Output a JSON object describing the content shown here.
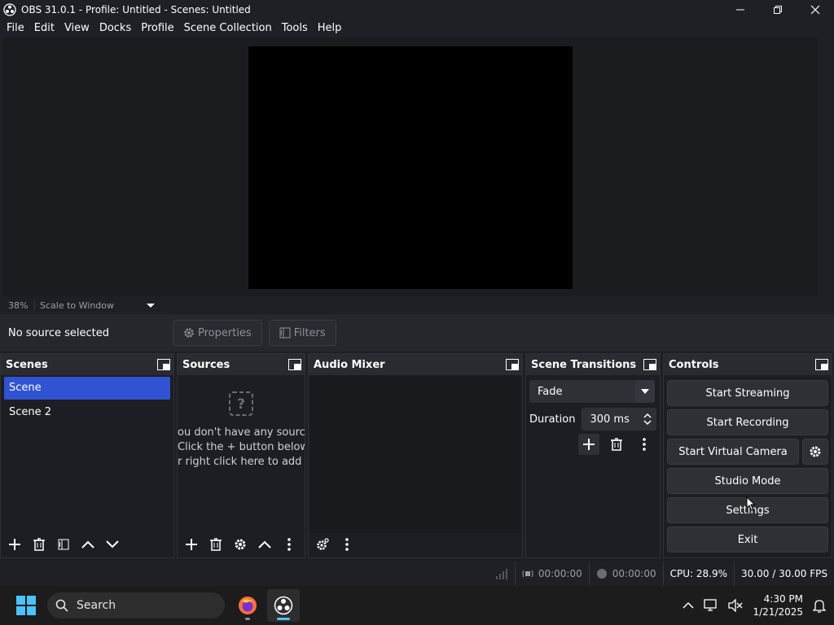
{
  "window": {
    "title": "OBS 31.0.1 - Profile: Untitled - Scenes: Untitled"
  },
  "menu": [
    "File",
    "Edit",
    "View",
    "Docks",
    "Profile",
    "Scene Collection",
    "Tools",
    "Help"
  ],
  "preview": {
    "zoom": "38%",
    "scale_mode": "Scale to Window"
  },
  "source_bar": {
    "status": "No source selected",
    "properties_label": "Properties",
    "filters_label": "Filters"
  },
  "scenes": {
    "title": "Scenes",
    "items": [
      {
        "label": "Scene",
        "selected": true
      },
      {
        "label": "Scene 2",
        "selected": false
      }
    ]
  },
  "sources": {
    "title": "Sources",
    "empty_lines": [
      "ou don't have any source",
      "Click the + button below,",
      "r right click here to add or"
    ]
  },
  "audio_mixer": {
    "title": "Audio Mixer"
  },
  "transitions": {
    "title": "Scene Transitions",
    "selected": "Fade",
    "duration_label": "Duration",
    "duration_value": "300 ms"
  },
  "controls": {
    "title": "Controls",
    "start_streaming": "Start Streaming",
    "start_recording": "Start Recording",
    "start_virtual_camera": "Start Virtual Camera",
    "studio_mode": "Studio Mode",
    "settings": "Settings",
    "exit": "Exit"
  },
  "status": {
    "stream_time": "00:00:00",
    "record_time": "00:00:00",
    "cpu": "CPU: 28.9%",
    "fps": "30.00 / 30.00 FPS"
  },
  "taskbar": {
    "search_placeholder": "Search",
    "time": "4:30 PM",
    "date": "1/21/2025"
  },
  "colors": {
    "accent_selected": "#2f53d1",
    "background": "#1e1f24",
    "panel": "#2a2b31"
  }
}
